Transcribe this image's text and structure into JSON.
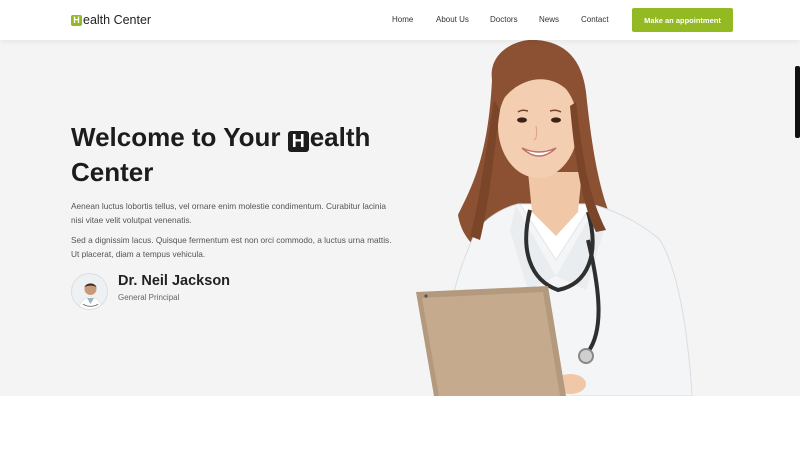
{
  "header": {
    "logo_initial": "H",
    "logo_rest": "ealth Center",
    "nav": [
      "Home",
      "About Us",
      "Doctors",
      "News",
      "Contact"
    ],
    "cta_label": "Make an appointment"
  },
  "hero": {
    "title_part1": "Welcome to Your ",
    "title_badge": "H",
    "title_part2": "ealth",
    "title_line2": "Center",
    "paragraph1": "Aenean luctus lobortis tellus, vel ornare enim molestie condimentum. Curabitur lacinia nisi vitae velit volutpat venenatis.",
    "paragraph2": "Sed a dignissim lacus. Quisque fermentum est non orci commodo, a luctus urna mattis. Ut placerat, diam a tempus vehicula.",
    "doctor": {
      "name": "Dr. Neil Jackson",
      "role": "General Principal"
    }
  },
  "colors": {
    "accent": "#93b923",
    "hero_bg": "#f4f4f4",
    "text_dark": "#1c1c1c"
  }
}
